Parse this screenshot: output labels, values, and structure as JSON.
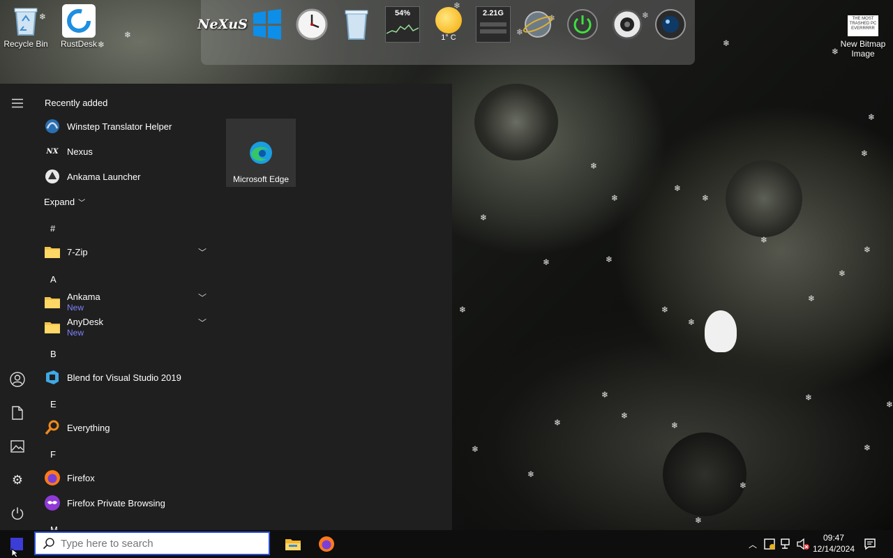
{
  "desktop": {
    "icons": [
      {
        "label": "Recycle Bin",
        "icon": "recycle-bin-icon"
      },
      {
        "label": "RustDesk",
        "icon": "rustdesk-icon"
      },
      {
        "label": "New Bitmap Image",
        "icon": "bitmap-image-icon",
        "thumb_text": "THE MOST TRASHED PC EVERRRRR"
      }
    ]
  },
  "dock": {
    "items": [
      {
        "name": "nexus",
        "label": "NeXuS"
      },
      {
        "name": "windows",
        "label": ""
      },
      {
        "name": "clock",
        "label": ""
      },
      {
        "name": "recycle-bin",
        "label": ""
      },
      {
        "name": "cpu-meter",
        "label": "54%"
      },
      {
        "name": "weather",
        "label": "1° C"
      },
      {
        "name": "memory-meter",
        "label": "2.21G"
      },
      {
        "name": "internet",
        "label": ""
      },
      {
        "name": "shutdown",
        "label": ""
      },
      {
        "name": "audio",
        "label": ""
      },
      {
        "name": "webcam",
        "label": ""
      }
    ]
  },
  "start_menu": {
    "recently_added_label": "Recently added",
    "recent": [
      {
        "label": "Winstep Translator Helper",
        "icon": "winstep-translator-icon"
      },
      {
        "label": "Nexus",
        "icon": "nexus-icon"
      },
      {
        "label": "Ankama Launcher",
        "icon": "ankama-launcher-icon"
      }
    ],
    "expand_label": "Expand",
    "sections": [
      {
        "letter": "#",
        "apps": [
          {
            "label": "7-Zip",
            "badge": "",
            "folder": true
          }
        ]
      },
      {
        "letter": "A",
        "apps": [
          {
            "label": "Ankama",
            "badge": "New",
            "folder": true
          },
          {
            "label": "AnyDesk",
            "badge": "New",
            "folder": true
          }
        ]
      },
      {
        "letter": "B",
        "apps": [
          {
            "label": "Blend for Visual Studio 2019",
            "badge": "",
            "folder": false
          }
        ]
      },
      {
        "letter": "E",
        "apps": [
          {
            "label": "Everything",
            "badge": "",
            "folder": false
          }
        ]
      },
      {
        "letter": "F",
        "apps": [
          {
            "label": "Firefox",
            "badge": "",
            "folder": false
          },
          {
            "label": "Firefox Private Browsing",
            "badge": "",
            "folder": false
          }
        ]
      },
      {
        "letter": "M",
        "apps": []
      }
    ],
    "tiles": [
      {
        "label": "Microsoft Edge",
        "icon": "edge-icon"
      }
    ]
  },
  "taskbar": {
    "search_placeholder": "Type here to search",
    "clock_time": "09:47",
    "clock_date": "12/14/2024"
  },
  "colors": {
    "start_bg": "#1f1f1f",
    "taskbar_bg": "#0e0e0e",
    "accent_new": "#7d83ff",
    "search_border": "#2c4fd6"
  }
}
